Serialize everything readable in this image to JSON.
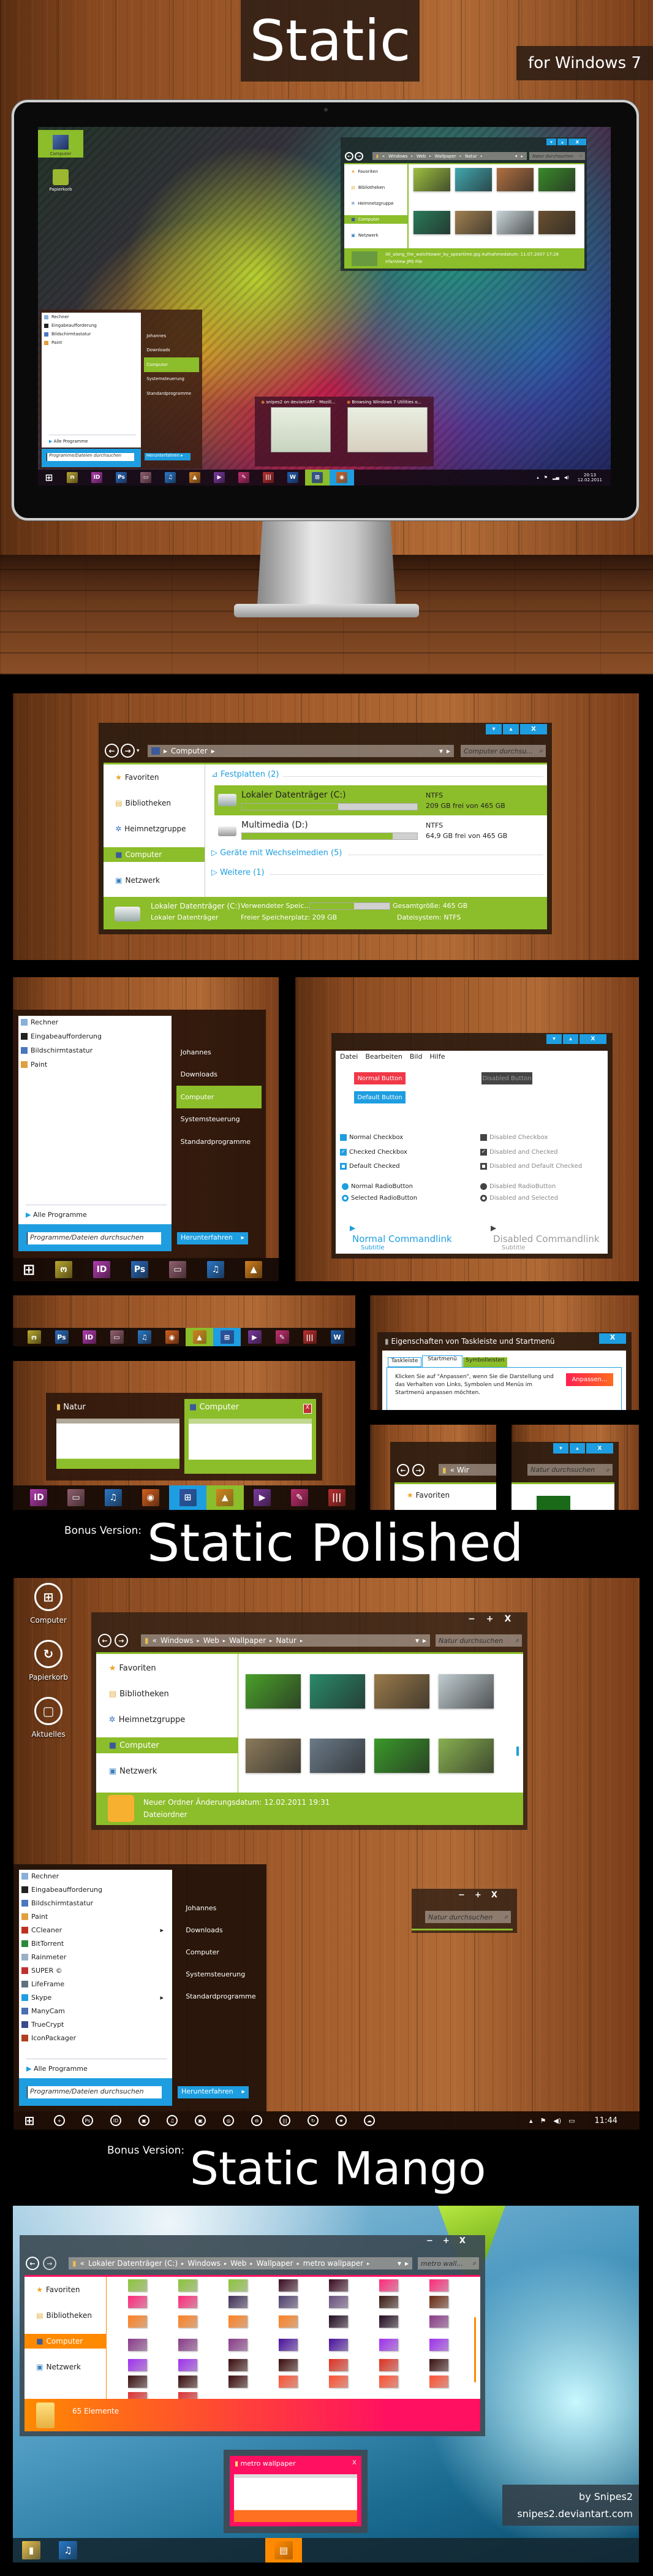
{
  "colors": {
    "accent_green": "#8cbd2a",
    "accent_blue": "#1e9ee0",
    "mango_orange": "#ff8a00",
    "mango_pink": "#ff1060",
    "button_red": "#f03848"
  },
  "hero": {
    "title": "Static",
    "subtitle": "for Windows 7"
  },
  "desktop1": {
    "icons": [
      {
        "label": "Computer"
      },
      {
        "label": "Papierkorb"
      }
    ],
    "explorer": {
      "buttons": [
        "▾",
        "▴",
        "X"
      ],
      "address": [
        "Windows",
        "Web",
        "Wallpaper",
        "Natur"
      ],
      "search_placeholder": "Natur durchsuchen",
      "nav": [
        "Favoriten",
        "Bibliotheken",
        "Heimnetzgruppe",
        "Computer",
        "Netzwerk"
      ],
      "selected_nav": "Computer",
      "thumb_colors": [
        "#9cc040",
        "#40a8b0",
        "#b07040",
        "#3a8a2a",
        "#2a7a5a",
        "#a08050",
        "#c8d4d8",
        "#6a5030"
      ],
      "status_line1": "All_along_the_watchtower_by_speartime.jpg Aufnahmedatum: 11.07.2007 17:28",
      "status_line2": "IrfanView JPG File"
    },
    "start_menu": {
      "programs": [
        "Rechner",
        "Eingabeaufforderung",
        "Bildschirmtastatur",
        "Paint"
      ],
      "all_programs": "Alle Programme",
      "search_placeholder": "Programme/Dateien durchsuchen",
      "places": [
        "Johannes",
        "Downloads",
        "Computer",
        "Systemsteuerung",
        "Standardprogramme"
      ],
      "selected_place": "Computer",
      "shutdown": "Herunterfahren"
    },
    "peek": [
      "snipes2 on deviantART - Mozill...",
      "Browsing Windows 7 Utilities o..."
    ],
    "taskbar": {
      "icons": [
        {
          "icon": "tablet-app-icon",
          "glyph": "ო",
          "color": "#b8a830"
        },
        {
          "icon": "indesign-icon",
          "glyph": "ID",
          "color": "#b03cb0"
        },
        {
          "icon": "photoshop-icon",
          "glyph": "Ps",
          "color": "#2a6ab8"
        },
        {
          "icon": "monitor-icon",
          "glyph": "▭",
          "color": "#906070"
        },
        {
          "icon": "itunes-icon",
          "glyph": "♫",
          "color": "#2a78c8"
        },
        {
          "icon": "vlc-icon",
          "glyph": "▲",
          "color": "#d08020"
        },
        {
          "icon": "media-player-icon",
          "glyph": "▶",
          "color": "#7a3aa0"
        },
        {
          "icon": "inkscape-icon",
          "glyph": "✎",
          "color": "#c03070"
        },
        {
          "icon": "barcode-app-icon",
          "glyph": "|||",
          "color": "#b83030"
        },
        {
          "icon": "word-icon",
          "glyph": "W",
          "color": "#2060b0"
        },
        {
          "icon": "explorer-icon",
          "glyph": "⊞",
          "color": "#3050a0",
          "active": "green"
        },
        {
          "icon": "firefox-icon",
          "glyph": "◉",
          "color": "#d06020",
          "active": "blue"
        }
      ],
      "time": "20:13",
      "date": "12.02.2011"
    }
  },
  "computer_window": {
    "buttons": [
      "▾",
      "▴",
      "X"
    ],
    "address": "Computer",
    "search_placeholder": "Computer durchsu...",
    "nav": [
      "Favoriten",
      "Bibliotheken",
      "Heimnetzgruppe",
      "Computer",
      "Netzwerk"
    ],
    "selected_nav": "Computer",
    "group_disks": "Festplatten (2)",
    "drives": [
      {
        "name": "Lokaler Datenträger (C:)",
        "fs": "NTFS",
        "free": "209 GB frei von 465 GB",
        "used_percent": 55,
        "selected": true
      },
      {
        "name": "Multimedia (D:)",
        "fs": "NTFS",
        "free": "64,9 GB frei von 465 GB",
        "used_percent": 86,
        "selected": false
      }
    ],
    "group_removable": "Geräte mit Wechselmedien (5)",
    "group_other": "Weitere (1)",
    "status": {
      "title": "Lokaler Datenträger (C:)",
      "type": "Lokaler Datenträger",
      "used_label": "Verwendeter Speic...",
      "used_percent": 55,
      "free": "Freier Speicherplatz: 209 GB",
      "total": "Gesamtgröße: 465 GB",
      "fs": "Dateisystem: NTFS"
    }
  },
  "start_menu2": {
    "programs": [
      "Rechner",
      "Eingabeaufforderung",
      "Bildschirmtastatur",
      "Paint"
    ],
    "all_programs": "Alle Programme",
    "search_placeholder": "Programme/Dateien durchsuchen",
    "places": [
      "Johannes",
      "Downloads",
      "Computer",
      "Systemsteuerung",
      "Standardprogramme"
    ],
    "selected_place": "Computer",
    "shutdown": "Herunterfahren",
    "taskbar": [
      {
        "icon": "tablet-app-icon",
        "glyph": "ო",
        "color": "#b8a830"
      },
      {
        "icon": "indesign-icon",
        "glyph": "ID",
        "color": "#b03cb0"
      },
      {
        "icon": "photoshop-icon",
        "glyph": "Ps",
        "color": "#2a6ab8"
      },
      {
        "icon": "monitor-icon",
        "glyph": "▭",
        "color": "#906070"
      },
      {
        "icon": "itunes-icon",
        "glyph": "♫",
        "color": "#2a78c8"
      },
      {
        "icon": "vlc-icon",
        "glyph": "▲",
        "color": "#d08020"
      }
    ]
  },
  "controls": {
    "buttons": [
      "▾",
      "▴",
      "X"
    ],
    "menu": [
      "Datei",
      "Bearbeiten",
      "Bild",
      "Hilfe"
    ],
    "normal_button": "Normal Button",
    "default_button": "Default Button",
    "disabled_button": "Disabled Button",
    "checkboxes": [
      {
        "label": "Normal Checkbox",
        "state": "unchecked"
      },
      {
        "label": "Checked Checkbox",
        "state": "checked"
      },
      {
        "label": "Default Checked",
        "state": "default"
      }
    ],
    "disabled_checkboxes": [
      {
        "label": "Disabled Checkbox",
        "state": "unchecked"
      },
      {
        "label": "Disabled and Checked",
        "state": "checked"
      },
      {
        "label": "Disabled and Default Checked",
        "state": "default"
      }
    ],
    "radios": [
      {
        "label": "Normal RadioButton",
        "state": "unselected"
      },
      {
        "label": "Selected RadioButton",
        "state": "selected"
      }
    ],
    "disabled_radios": [
      {
        "label": "Disabled RadioButton",
        "state": "unselected"
      },
      {
        "label": "Disabled and Selected",
        "state": "selected"
      }
    ],
    "commandlink": {
      "label": "Normal Commandlink",
      "subtitle": "Subtitle"
    },
    "disabled_commandlink": {
      "label": "Disabled Commandlink",
      "subtitle": "Subtitle"
    }
  },
  "taskbar_strip": [
    {
      "icon": "tablet-app-icon",
      "glyph": "ო",
      "color": "#b8a830"
    },
    {
      "icon": "photoshop-icon",
      "glyph": "Ps",
      "color": "#2a6ab8"
    },
    {
      "icon": "indesign-icon",
      "glyph": "ID",
      "color": "#b03cb0"
    },
    {
      "icon": "monitor-icon",
      "glyph": "▭",
      "color": "#906070"
    },
    {
      "icon": "itunes-icon",
      "glyph": "♫",
      "color": "#2a78c8"
    },
    {
      "icon": "firefox-icon",
      "glyph": "◉",
      "color": "#d06020"
    },
    {
      "icon": "vlc-icon",
      "glyph": "▲",
      "color": "#d08020",
      "active": "green"
    },
    {
      "icon": "explorer-icon",
      "glyph": "⊞",
      "color": "#3050a0",
      "active": "blue"
    },
    {
      "icon": "media-player-icon",
      "glyph": "▶",
      "color": "#7a3aa0"
    },
    {
      "icon": "inkscape-icon",
      "glyph": "✎",
      "color": "#c03070"
    },
    {
      "icon": "barcode-app-icon",
      "glyph": "|||",
      "color": "#b83030"
    },
    {
      "icon": "word-icon",
      "glyph": "W",
      "color": "#2060b0"
    }
  ],
  "aero_peek": {
    "windows": [
      {
        "title": "Natur"
      },
      {
        "title": "Computer",
        "close": "X"
      }
    ],
    "taskbar": [
      {
        "icon": "indesign-icon",
        "glyph": "ID",
        "color": "#b03cb0"
      },
      {
        "icon": "monitor-icon",
        "glyph": "▭",
        "color": "#906070"
      },
      {
        "icon": "itunes-icon",
        "glyph": "♫",
        "color": "#2a78c8"
      },
      {
        "icon": "firefox-icon",
        "glyph": "◉",
        "color": "#d06020"
      },
      {
        "icon": "explorer-icon",
        "glyph": "⊞",
        "color": "#3050a0",
        "active": "blue"
      },
      {
        "icon": "vlc-icon",
        "glyph": "▲",
        "color": "#d08020",
        "active": "green"
      },
      {
        "icon": "media-player-icon",
        "glyph": "▶",
        "color": "#7a3aa0"
      },
      {
        "icon": "inkscape-icon",
        "glyph": "✎",
        "color": "#c03070"
      },
      {
        "icon": "barcode-app-icon",
        "glyph": "|||",
        "color": "#b83030"
      }
    ]
  },
  "properties_dialog": {
    "title": "Eigenschaften von Taskleiste und Startmenü",
    "close": "X",
    "tabs": [
      "Taskleiste",
      "Startmenü",
      "Symbolleisten"
    ],
    "active_tab": "Startmenü",
    "text": "Klicken Sie auf \"Anpassen\", wenn Sie die Darstellung und das Verhalten von Links, Symbolen und Menüs im Startmenü anpassen möchten.",
    "customize_button": "Anpassen..."
  },
  "detail_left": {
    "address": "« Wir",
    "nav_item": "Favoriten"
  },
  "detail_right": {
    "buttons": [
      "▾",
      "▴",
      "X"
    ],
    "search_placeholder": "Natur durchsuchen"
  },
  "polished": {
    "bonus_label": "Bonus Version:",
    "title": "Static Polished",
    "desktop_icons": [
      {
        "label": "Computer",
        "glyph": "⊞"
      },
      {
        "label": "Papierkorb",
        "glyph": "↻"
      },
      {
        "label": "Aktuelles",
        "glyph": "▢"
      }
    ],
    "window": {
      "buttons": [
        "−",
        "+",
        "X"
      ],
      "address": [
        "Windows",
        "Web",
        "Wallpaper",
        "Natur"
      ],
      "search_placeholder": "Natur durchsuchen",
      "nav": [
        "Favoriten",
        "Bibliotheken",
        "Heimnetzgruppe",
        "Computer",
        "Netzwerk"
      ],
      "selected_nav": "Computer",
      "thumb_colors": [
        "#4aa02a",
        "#2a8a6a",
        "#9a7a4a",
        "#c0ccd0",
        "#8a7a5a",
        "#6a7a88",
        "#3a9a2a",
        "#88b050"
      ],
      "status_line1": "Neuer Ordner  Änderungsdatum: 12.02.2011 19:31",
      "status_line2": "Dateiordner"
    },
    "start_menu": {
      "programs": [
        {
          "label": "Rechner"
        },
        {
          "label": "Eingabeaufforderung"
        },
        {
          "label": "Bildschirmtastatur"
        },
        {
          "label": "Paint"
        },
        {
          "label": "CCleaner",
          "submenu": true
        },
        {
          "label": "BitTorrent"
        },
        {
          "label": "Rainmeter"
        },
        {
          "label": "SUPER ©"
        },
        {
          "label": "LifeFrame"
        },
        {
          "label": "Skype",
          "submenu": true
        },
        {
          "label": "ManyCam"
        },
        {
          "label": "TrueCrypt"
        },
        {
          "label": "IconPackager"
        }
      ],
      "all_programs": "Alle Programme",
      "search_placeholder": "Programme/Dateien durchsuchen",
      "places": [
        "Johannes",
        "Downloads",
        "Computer",
        "Systemsteuerung",
        "Standardprogramme"
      ],
      "shutdown": "Herunterfahren"
    },
    "mini_window": {
      "buttons": [
        "−",
        "+",
        "X"
      ],
      "search_placeholder": "Natur durchsuchen"
    },
    "taskbar": {
      "icons": [
        "+",
        "Ps",
        "ID",
        "▣",
        "♫",
        "▣",
        "◎",
        "⊖",
        "|||",
        "↻",
        "★",
        "☁"
      ],
      "time": "11:44"
    }
  },
  "mango": {
    "bonus_label": "Bonus Version:",
    "title": "Static Mango",
    "window": {
      "buttons": [
        "−",
        "+",
        "X"
      ],
      "address": [
        "Lokaler Datenträger (C:)",
        "Windows",
        "Web",
        "Wallpaper",
        "metro wallpaper"
      ],
      "search_placeholder": "metro wall...",
      "nav": [
        "Favoriten",
        "Bibliotheken",
        "Computer",
        "Netzwerk"
      ],
      "selected_nav": "Computer",
      "thumb_colors": [
        "#8cc43a",
        "#8cc43a",
        "#8cc43a",
        "#3a0a20",
        "#3a0a20",
        "#ff2a7a",
        "#ff2a7a",
        "#ff2a7a",
        "#ff2a7a",
        "#40305a",
        "#504070",
        "#6a5080",
        "#3a1a10",
        "#6a2a10",
        "#ff8020",
        "#ff8020",
        "#ff8020",
        "#ff8020",
        "#200a20",
        "#200a20",
        "#8a3a8a",
        "#8a3a8a",
        "#8a3a8a",
        "#8a3a8a",
        "#4a10a0",
        "#4a10a0",
        "#a030f0",
        "#a030f0",
        "#a030f0",
        "#a030f0",
        "#3a0a0a",
        "#3a0a0a",
        "#e03020",
        "#e03020",
        "#3a1010",
        "#3a1010",
        "#3a0a0a",
        "#3a0a0a",
        "#ff5030",
        "#ff5030",
        "#ff5030",
        "#ff5030",
        "#e03030",
        "#e03030"
      ],
      "status": "65 Elemente"
    },
    "peek": {
      "title": "metro wallpaper",
      "close": "X"
    },
    "credit": {
      "author": "by Snipes2",
      "site": "snipes2.deviantart.com"
    },
    "taskbar": [
      {
        "icon": "folder-icon",
        "glyph": "▮",
        "color": "#e8c050"
      },
      {
        "icon": "itunes-icon",
        "glyph": "♫",
        "color": "#2a78c8"
      },
      {
        "icon": "explorer-icon",
        "glyph": "▤",
        "color": "#ff8a00",
        "active": "orange"
      }
    ]
  }
}
